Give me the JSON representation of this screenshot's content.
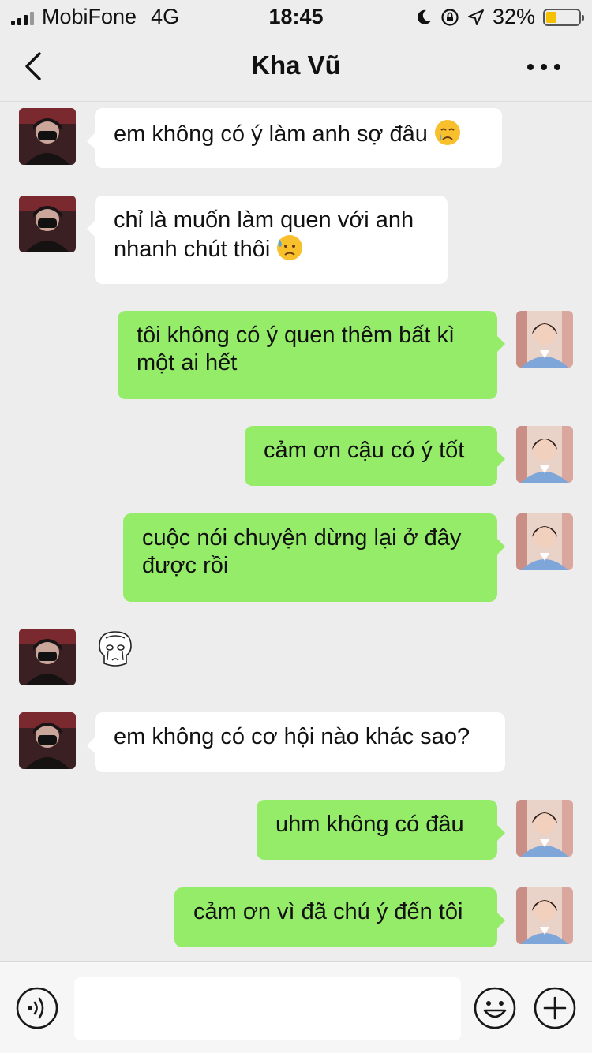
{
  "status_bar": {
    "carrier": "MobiFone",
    "network": "4G",
    "time": "18:45",
    "battery": "32%",
    "battery_level": 0.32
  },
  "header": {
    "title": "Kha Vũ",
    "back_icon": "chevron-left-icon",
    "more_icon": "more-dots-icon"
  },
  "messages": [
    {
      "side": "in",
      "text": "em không có ý làm anh sợ đâu",
      "emoji": "crying-face"
    },
    {
      "side": "in",
      "text": "chỉ là muốn làm quen với anh",
      "text2": "nhanh chút thôi",
      "emoji": "sad-sweat-face"
    },
    {
      "side": "out",
      "text": "tôi không có ý quen thêm bất kì",
      "text2": "một ai hết"
    },
    {
      "side": "out",
      "text": "cảm ơn cậu có ý tốt"
    },
    {
      "side": "out",
      "text": "cuộc nói chuyện dừng lại ở đây",
      "text2": "được rồi"
    },
    {
      "side": "in",
      "type": "sticker",
      "sticker": "crying-character-sticker"
    },
    {
      "side": "in",
      "text": "em không có cơ hội nào khác sao?"
    },
    {
      "side": "out",
      "text": "uhm không có đâu"
    },
    {
      "side": "out",
      "text": "cảm ơn vì đã chú ý đến tôi"
    }
  ],
  "input_bar": {
    "voice_icon": "voice-icon",
    "emoji_icon": "smile-icon",
    "plus_icon": "plus-icon",
    "input_value": ""
  },
  "colors": {
    "background": "#EDEDED",
    "outgoing_bubble": "#95EC69",
    "incoming_bubble": "#FFFFFF",
    "battery_fill": "#F5C000"
  }
}
